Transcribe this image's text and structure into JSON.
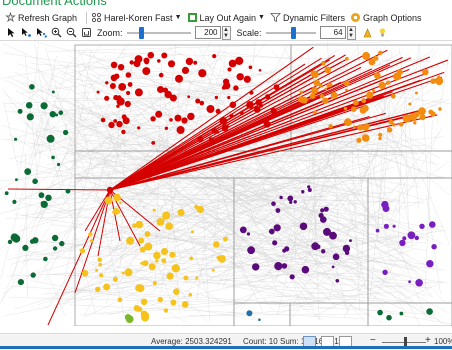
{
  "header": {
    "title": "Document Actions"
  },
  "toolbar": {
    "refresh_label": "Refresh Graph",
    "layout_algorithm": "Harel-Koren Fast",
    "layout_again_label": "Lay Out Again",
    "dynamic_filters_label": "Dynamic Filters",
    "graph_options_label": "Graph Options",
    "zoom_label": "Zoom:",
    "zoom_value": "200",
    "scale_label": "Scale:",
    "scale_value": "64"
  },
  "colors": {
    "red": "#d40000",
    "orange": "#f28c0f",
    "green": "#0c6b35",
    "yellow": "#f6c21c",
    "purple": "#5a0a7a",
    "violet": "#7a1fbf",
    "edges": "#cfcfcf",
    "accent": "#1f9a4f"
  },
  "statusbar": {
    "average": "Average: 2503.324291",
    "count": "Count: 10",
    "sum": "Sum: 12516.62145",
    "zoom_minus": "−",
    "zoom_plus": "+",
    "zoom_percent": "100%"
  }
}
